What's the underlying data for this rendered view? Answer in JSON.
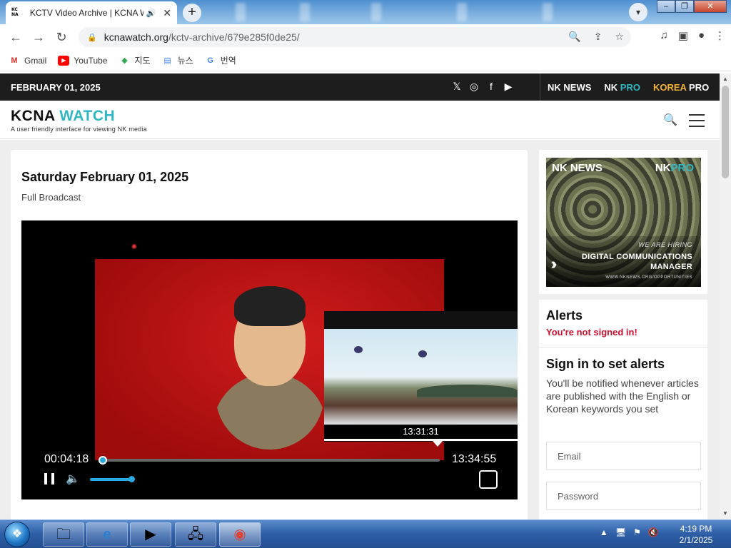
{
  "browser": {
    "tab_title": "KCTV Video Archive | KCNA Watch",
    "tab_favicon": "KC NA",
    "url_domain": "kcnawatch.org",
    "url_path": "/kctv-archive/679e285f0de25/"
  },
  "bookmarks": [
    {
      "label": "Gmail",
      "icon": "gmail-icon"
    },
    {
      "label": "YouTube",
      "icon": "youtube-icon"
    },
    {
      "label": "지도",
      "icon": "maps-icon"
    },
    {
      "label": "뉴스",
      "icon": "news-icon"
    },
    {
      "label": "번역",
      "icon": "translate-icon"
    }
  ],
  "site": {
    "date_bar": "FEBRUARY 01, 2025",
    "brand_nknews": "NK NEWS",
    "brand_nkpro_a": "NK ",
    "brand_nkpro_b": "PRO",
    "brand_korea_a": "KOREA ",
    "brand_korea_b": "PRO",
    "logo_a": "KCNA ",
    "logo_b": "WATCH",
    "tagline": "A user friendly interface for viewing NK media"
  },
  "main": {
    "title": "Saturday February 01, 2025",
    "subtitle": "Full Broadcast"
  },
  "video": {
    "current_time": "00:04:18",
    "duration": "13:34:55",
    "hover_time": "13:31:31",
    "progress_fraction": 0.005,
    "volume_fraction": 1.0
  },
  "ad": {
    "nknews": "NK NEWS",
    "nkpro_a": "NK",
    "nkpro_b": "PRO",
    "hiring": "WE ARE HIRING",
    "title_line1": "DIGITAL COMMUNICATIONS",
    "title_line2": "MANAGER",
    "url": "WWW.NKNEWS.ORG/OPPORTUNITIES"
  },
  "alerts": {
    "heading": "Alerts",
    "not_signed": "You're not signed in!",
    "signin_heading": "Sign in to set alerts",
    "description": "You'll be notified whenever articles are published with the English or Korean keywords you set",
    "email_placeholder": "Email",
    "password_placeholder": "Password"
  },
  "taskbar": {
    "time": "4:19 PM",
    "date": "2/1/2025"
  },
  "colors": {
    "accent_teal": "#2fb7c2",
    "alert_red": "#c8102e",
    "korea_pro_gold": "#f2b233",
    "seek_blue": "#2aa8e0"
  }
}
